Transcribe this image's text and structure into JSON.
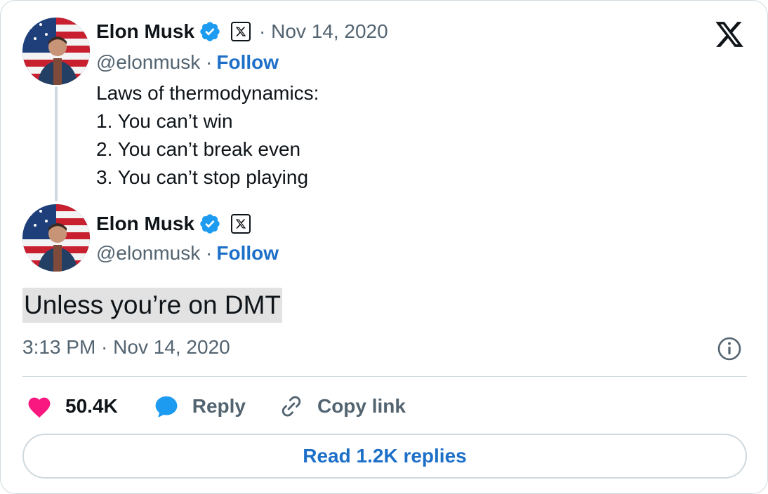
{
  "brand": {
    "accent": "#1d6fc8",
    "like": "#f91880",
    "reply_icon": "#1d9bf0",
    "logo_icon": "x-logo-icon"
  },
  "quoted_tweet": {
    "author_name": "Elon Musk",
    "date": "· Nov 14, 2020",
    "handle": "@elonmusk ·",
    "follow_label": "Follow",
    "lines": [
      "Laws of thermodynamics:",
      "1. You can’t win",
      "2. You can’t break even",
      "3. You can’t stop playing"
    ]
  },
  "tweet": {
    "author_name": "Elon Musk",
    "handle": "@elonmusk ·",
    "follow_label": "Follow",
    "text": "Unless you’re on DMT",
    "timestamp": "3:13 PM · Nov 14, 2020"
  },
  "actions": {
    "likes": "50.4K",
    "reply_label": "Reply",
    "copy_link_label": "Copy link"
  },
  "read_replies_label": "Read 1.2K replies"
}
